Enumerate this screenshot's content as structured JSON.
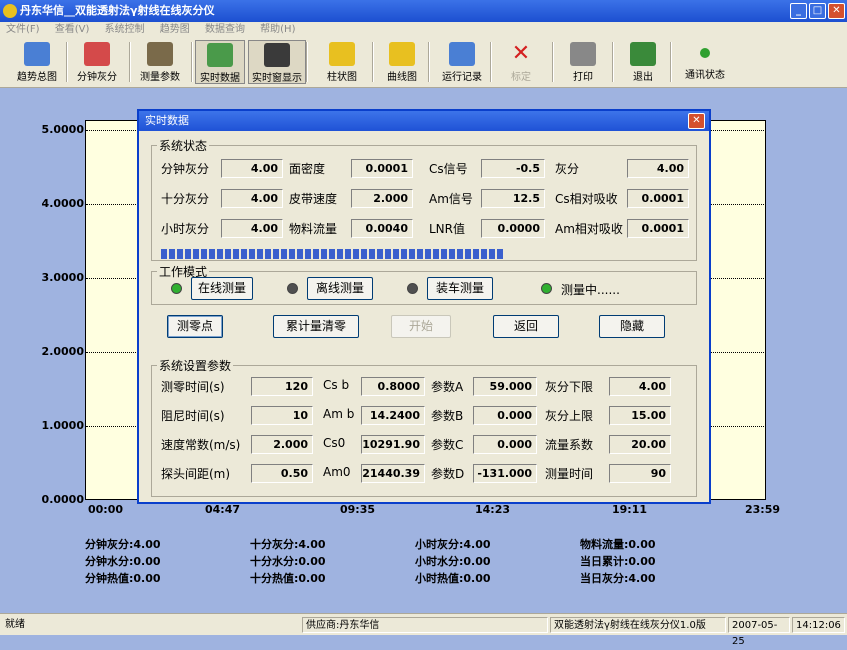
{
  "window": {
    "title": "丹东华信__双能透射法γ射线在线灰分仪",
    "min": "_",
    "max": "□",
    "close": "✕"
  },
  "menu": [
    "文件(F)",
    "查看(V)",
    "系统控制",
    "趋势图",
    "数据查询",
    "帮助(H)"
  ],
  "toolbar": {
    "items": [
      {
        "label": "趋势总图",
        "icon": "trend-chart-icon",
        "color": "#4a7fd4"
      },
      {
        "label": "分钟灰分",
        "icon": "pie-chart-icon",
        "color": "#d44a4a"
      },
      {
        "label": "测量参数",
        "icon": "parameters-icon",
        "color": "#7a6a4a"
      },
      {
        "label": "实时数据",
        "icon": "realtime-data-icon",
        "color": "#4a9a4a"
      },
      {
        "label": "实时窗显示",
        "icon": "monitor-icon",
        "color": "#3a3a3a"
      },
      {
        "label": "柱状图",
        "icon": "bar-chart-icon",
        "color": "#e8c020"
      },
      {
        "label": "曲线图",
        "icon": "line-chart-icon",
        "color": "#e8c020"
      },
      {
        "label": "运行记录",
        "icon": "records-icon",
        "color": "#4a7fd4"
      },
      {
        "label": "标定",
        "icon": "calibrate-icon",
        "color": "#d42020"
      },
      {
        "label": "打印",
        "icon": "printer-icon",
        "color": "#888888"
      },
      {
        "label": "退出",
        "icon": "exit-icon",
        "color": "#3a8a3a"
      },
      {
        "label": "通讯状态",
        "icon": "comm-status-icon",
        "color": "#30a030"
      }
    ]
  },
  "chart_data": {
    "type": "line",
    "y_ticks": [
      "5.0000",
      "4.0000",
      "3.0000",
      "2.0000",
      "1.0000",
      "0.0000"
    ],
    "x_ticks": [
      "00:00",
      "04:47",
      "09:35",
      "14:23",
      "19:11",
      "23:59"
    ],
    "ylim": [
      0,
      5
    ],
    "series": []
  },
  "stats": {
    "col1": [
      "分钟灰分:4.00",
      "分钟水分:0.00",
      "分钟热值:0.00"
    ],
    "col2": [
      "十分灰分:4.00",
      "十分水分:0.00",
      "十分热值:0.00"
    ],
    "col3": [
      "小时灰分:4.00",
      "小时水分:0.00",
      "小时热值:0.00"
    ],
    "col4": [
      "物料流量:0.00",
      "当日累计:0.00",
      "当日灰分:4.00"
    ]
  },
  "dialog": {
    "title": "实时数据",
    "close": "✕",
    "sys_status": {
      "title": "系统状态",
      "rows": [
        [
          {
            "l": "分钟灰分",
            "v": "4.00"
          },
          {
            "l": "面密度",
            "v": "0.0001"
          },
          {
            "l": "Cs信号",
            "v": "-0.5"
          },
          {
            "l": "灰分",
            "v": "4.00"
          }
        ],
        [
          {
            "l": "十分灰分",
            "v": "4.00"
          },
          {
            "l": "皮带速度",
            "v": "2.000"
          },
          {
            "l": "Am信号",
            "v": "12.5"
          },
          {
            "l": "Cs相对吸收",
            "v": "0.0001"
          }
        ],
        [
          {
            "l": "小时灰分",
            "v": "4.00"
          },
          {
            "l": "物料流量",
            "v": "0.0040"
          },
          {
            "l": "LNR值",
            "v": "0.0000"
          },
          {
            "l": "Am相对吸收",
            "v": "0.0001"
          }
        ]
      ],
      "progress": 0.65
    },
    "mode": {
      "title": "工作模式",
      "options": [
        {
          "label": "在线测量",
          "led": "#30b030"
        },
        {
          "label": "离线测量",
          "led": "#505050"
        },
        {
          "label": "装车测量",
          "led": "#505050"
        },
        {
          "label": "测量中......",
          "led": "#30b030"
        }
      ]
    },
    "buttons": [
      "测零点",
      "累计量清零",
      "开始",
      "返回",
      "隐藏"
    ],
    "settings": {
      "title": "系统设置参数",
      "rows": [
        [
          {
            "l": "测零时间(s)",
            "v": "120"
          },
          {
            "l": "Cs b",
            "v": "0.8000"
          },
          {
            "l": "参数A",
            "v": "59.000"
          },
          {
            "l": "灰分下限",
            "v": "4.00"
          }
        ],
        [
          {
            "l": "阻尼时间(s)",
            "v": "10"
          },
          {
            "l": "Am b",
            "v": "14.2400"
          },
          {
            "l": "参数B",
            "v": "0.000"
          },
          {
            "l": "灰分上限",
            "v": "15.00"
          }
        ],
        [
          {
            "l": "速度常数(m/s)",
            "v": "2.000"
          },
          {
            "l": "Cs0",
            "v": "10291.90"
          },
          {
            "l": "参数C",
            "v": "0.000"
          },
          {
            "l": "流量系数",
            "v": "20.00"
          }
        ],
        [
          {
            "l": "探头间距(m)",
            "v": "0.50"
          },
          {
            "l": "Am0",
            "v": "21440.39"
          },
          {
            "l": "参数D",
            "v": "-131.000"
          },
          {
            "l": "测量时间",
            "v": "90"
          }
        ]
      ]
    }
  },
  "statusbar": {
    "ready": "就绪",
    "supplier": "供应商:丹东华信",
    "product": "双能透射法γ射线在线灰分仪1.0版",
    "date": "2007-05-25",
    "time": "14:12:06"
  }
}
